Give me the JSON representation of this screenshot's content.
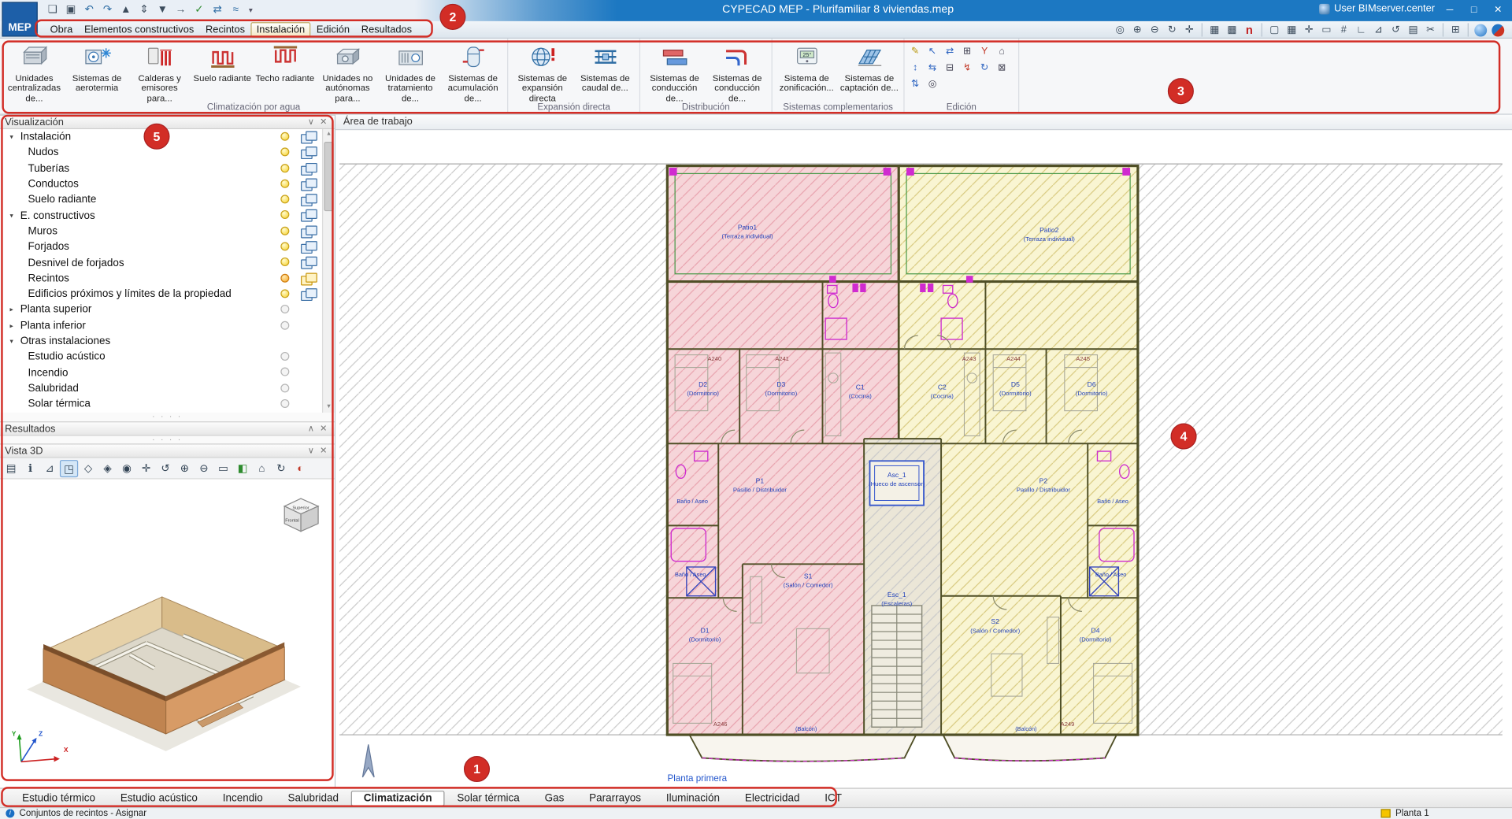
{
  "colors": {
    "titlebar_blue": "#1c78c2",
    "annotation_red": "#d22d26",
    "menu_active_bg": "#f3e7c4",
    "plan_pink": "#f6d5d9",
    "plan_yellow": "#f9f5d2",
    "accent_blue": "#2e6da4"
  },
  "titlebar": {
    "logo": "MEP",
    "title": "CYPECAD MEP - Plurifamiliar 8 viviendas.mep",
    "user": "User BIMserver.center"
  },
  "icons": {
    "tri_down": "▾",
    "tri_right": "▸",
    "panel_down": "∨",
    "panel_up": "∧",
    "close": "✕",
    "dots": "· · · ·",
    "win_min": "─",
    "win_max": "□",
    "win_close": "✕",
    "info": "i",
    "thermo": "25°",
    "scroll_up": "▲",
    "scroll_down": "▼",
    "quick": [
      "❏",
      "▣",
      "↶",
      "↷",
      "▲",
      "⇕",
      "▼",
      "→",
      "✓",
      "⇄",
      "≈",
      "▾"
    ],
    "view": [
      "◎",
      "⊕",
      "⊖",
      "↻",
      "✛",
      "▦",
      "▩",
      "n",
      "▢",
      "▦",
      "✛",
      "▭",
      "#",
      "∟",
      "⊿",
      "↺",
      "▤",
      "✂",
      "⊞"
    ],
    "v3d": [
      "▤",
      "ℹ",
      "⊿",
      "◳",
      "◇",
      "◈",
      "◉",
      "✛",
      "↺",
      "⊕",
      "⊖",
      "▭",
      "◧",
      "⌂",
      "↻",
      "◐"
    ],
    "edit": [
      "✎",
      "↖",
      "⇄",
      "⊞",
      "Y",
      "⌂",
      "↕",
      "⇆",
      "⊟",
      "↯",
      "↻",
      "⊠",
      "⇅",
      "◎"
    ]
  },
  "menubar": {
    "items": [
      "Obra",
      "Elementos constructivos",
      "Recintos",
      "Instalación",
      "Edición",
      "Resultados"
    ]
  },
  "ribbon": {
    "groups": [
      {
        "label": "Climatización por agua",
        "buttons": [
          "Unidades centralizadas de...",
          "Sistemas de aerotermia",
          "Calderas y emisores para...",
          "Suelo radiante",
          "Techo radiante",
          "Unidades no autónomas para...",
          "Unidades de tratamiento de...",
          "Sistemas de acumulación de..."
        ]
      },
      {
        "label": "Expansión directa",
        "buttons": [
          "Sistemas de expansión directa",
          "Sistemas de caudal de..."
        ]
      },
      {
        "label": "Distribución",
        "buttons": [
          "Sistemas de conducción de...",
          "Sistemas de conducción de..."
        ]
      },
      {
        "label": "Sistemas complementarios",
        "buttons": [
          "Sistema de zonificación...",
          "Sistemas de captación de..."
        ]
      },
      {
        "label": "Edición",
        "buttons": []
      }
    ]
  },
  "left": {
    "vis": {
      "title": "Visualización",
      "rows": [
        "Instalación",
        "Nudos",
        "Tuberías",
        "Conductos",
        "Suelo radiante",
        "E. constructivos",
        "Muros",
        "Forjados",
        "Desnivel de forjados",
        "Recintos",
        "Edificios próximos y límites de la propiedad",
        "Planta superior",
        "Planta inferior",
        "Otras instalaciones",
        "Estudio acústico",
        "Incendio",
        "Salubridad",
        "Solar térmica"
      ]
    },
    "res": {
      "title": "Resultados"
    },
    "v3d": {
      "title": "Vista 3D",
      "cube_top": "Superior",
      "cube_front": "Frontal",
      "ax_x": "X",
      "ax_y": "Y",
      "ax_z": "Z"
    }
  },
  "work": {
    "header": "Área de trabajo",
    "caption": "Planta primera"
  },
  "plan": {
    "patios": [
      {
        "id": "Patio1",
        "sub": "(Terraza individual)"
      },
      {
        "id": "Patio2",
        "sub": "(Terraza individual)"
      }
    ],
    "rooms": [
      {
        "id": "D2",
        "sub": "(Dormitorio)"
      },
      {
        "id": "D3",
        "sub": "(Dormitorio)"
      },
      {
        "id": "C1",
        "sub": "(Cocina)"
      },
      {
        "id": "C2",
        "sub": "(Cocina)"
      },
      {
        "id": "D5",
        "sub": "(Dormitorio)"
      },
      {
        "id": "D6",
        "sub": "(Dormitorio)"
      },
      {
        "id": "P1",
        "sub": "Pasillo / Distribuidor"
      },
      {
        "id": "P2",
        "sub": "Pasillo / Distribuidor"
      },
      {
        "id": "S1",
        "sub": "(Salón / Comedor)"
      },
      {
        "id": "S2",
        "sub": "(Salón / Comedor)"
      },
      {
        "id": "D1",
        "sub": "(Dormitorio)"
      },
      {
        "id": "D4",
        "sub": "(Dormitorio)"
      },
      {
        "id": "Asc_1",
        "sub": "(Hueco de ascensor)"
      },
      {
        "id": "Esc_1",
        "sub": "(Escaleras)"
      }
    ],
    "banos": [
      "Baño / Aseo",
      "Baño / Aseo",
      "Baño / Aseo",
      "Baño / Aseo"
    ],
    "balcones": [
      "(Balcón)",
      "(Balcón)"
    ],
    "refs": [
      "A240",
      "A241",
      "A243",
      "A244",
      "A245",
      "A246",
      "A249"
    ]
  },
  "tabs": {
    "items": [
      "Estudio térmico",
      "Estudio acústico",
      "Incendio",
      "Salubridad",
      "Climatización",
      "Solar térmica",
      "Gas",
      "Pararrayos",
      "Iluminación",
      "Electricidad",
      "ICT"
    ],
    "active": "Climatización"
  },
  "status": {
    "left": "Conjuntos de recintos - Asignar",
    "right": "Planta 1"
  },
  "ann": {
    "c1": "1",
    "c2": "2",
    "c3": "3",
    "c4": "4",
    "c5": "5"
  }
}
